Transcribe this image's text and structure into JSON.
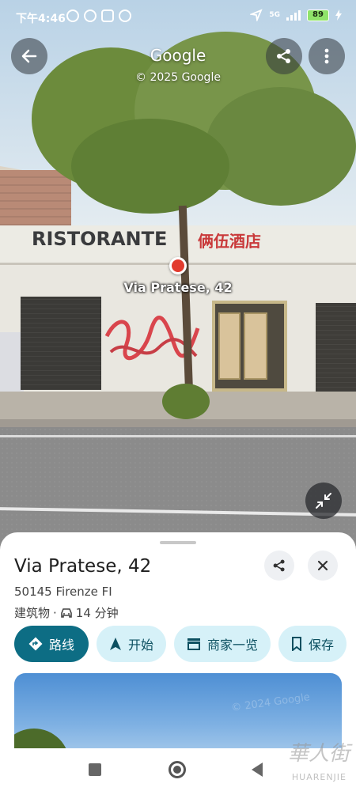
{
  "status_bar": {
    "time": "下午4:46",
    "network": "5G",
    "battery": "89"
  },
  "viewer": {
    "brand": "Google",
    "copyright": "© 2025 Google",
    "pin_label": "Via Pratese, 42",
    "sign_text": "RISTORANTE",
    "sign_cn": "俩伍酒店",
    "icons": {
      "back": "arrow-left-icon",
      "share": "share-icon",
      "more": "more-vert-icon",
      "collapse": "collapse-icon"
    }
  },
  "place": {
    "title": "Via Pratese, 42",
    "address": "50145 Firenze FI",
    "category": "建筑物",
    "separator": "·",
    "drive_time": "14 分钟"
  },
  "actions": [
    {
      "label": "路线",
      "icon": "directions-icon",
      "primary": true
    },
    {
      "label": "开始",
      "icon": "navigation-arrow-icon",
      "primary": false
    },
    {
      "label": "商家一览",
      "icon": "store-icon",
      "primary": false
    },
    {
      "label": "保存",
      "icon": "bookmark-icon",
      "primary": false
    }
  ],
  "photo_watermark": "© 2024 Google",
  "watermark": {
    "main": "華人街",
    "sub": "HUARENJIE"
  },
  "colors": {
    "primary": "#0d6d84",
    "chip_bg": "#d6f1f8",
    "pin": "#e23b2e"
  }
}
